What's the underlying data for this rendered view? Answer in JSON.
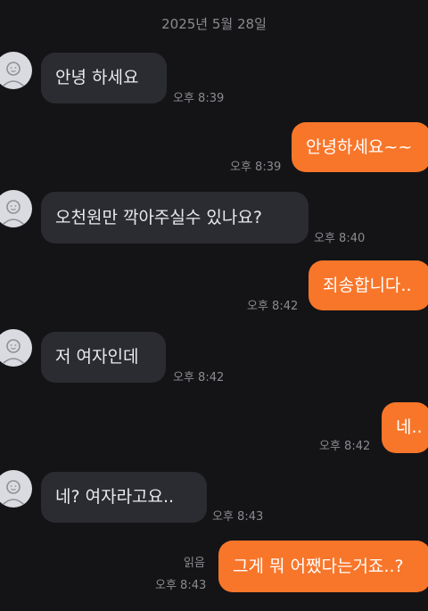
{
  "date_header": "2025년 5월 28일",
  "messages": [
    {
      "side": "in",
      "text": "안녕 하세요",
      "time": "오후 8:39"
    },
    {
      "side": "out",
      "text": "안녕하세요~~",
      "time": "오후 8:39"
    },
    {
      "side": "in",
      "text": "오천원만 깍아주실수 있나요?",
      "time": "오후 8:40"
    },
    {
      "side": "out",
      "text": "죄송합니다..",
      "time": "오후 8:42"
    },
    {
      "side": "in",
      "text": "저 여자인데",
      "time": "오후 8:42"
    },
    {
      "side": "out",
      "text": "네..",
      "time": "오후 8:42"
    },
    {
      "side": "in",
      "text": "네? 여자라고요..",
      "time": "오후 8:43"
    },
    {
      "side": "out",
      "text": "그게 뭐 어쨌다는거죠..?",
      "time": "오후 8:43",
      "read": "읽음"
    }
  ],
  "colors": {
    "background": "#141416",
    "incoming_bubble": "#2b2c31",
    "outgoing_bubble": "#f8762a",
    "meta_text": "#8a8b90"
  },
  "icons": {
    "avatar": "default-profile-icon"
  }
}
